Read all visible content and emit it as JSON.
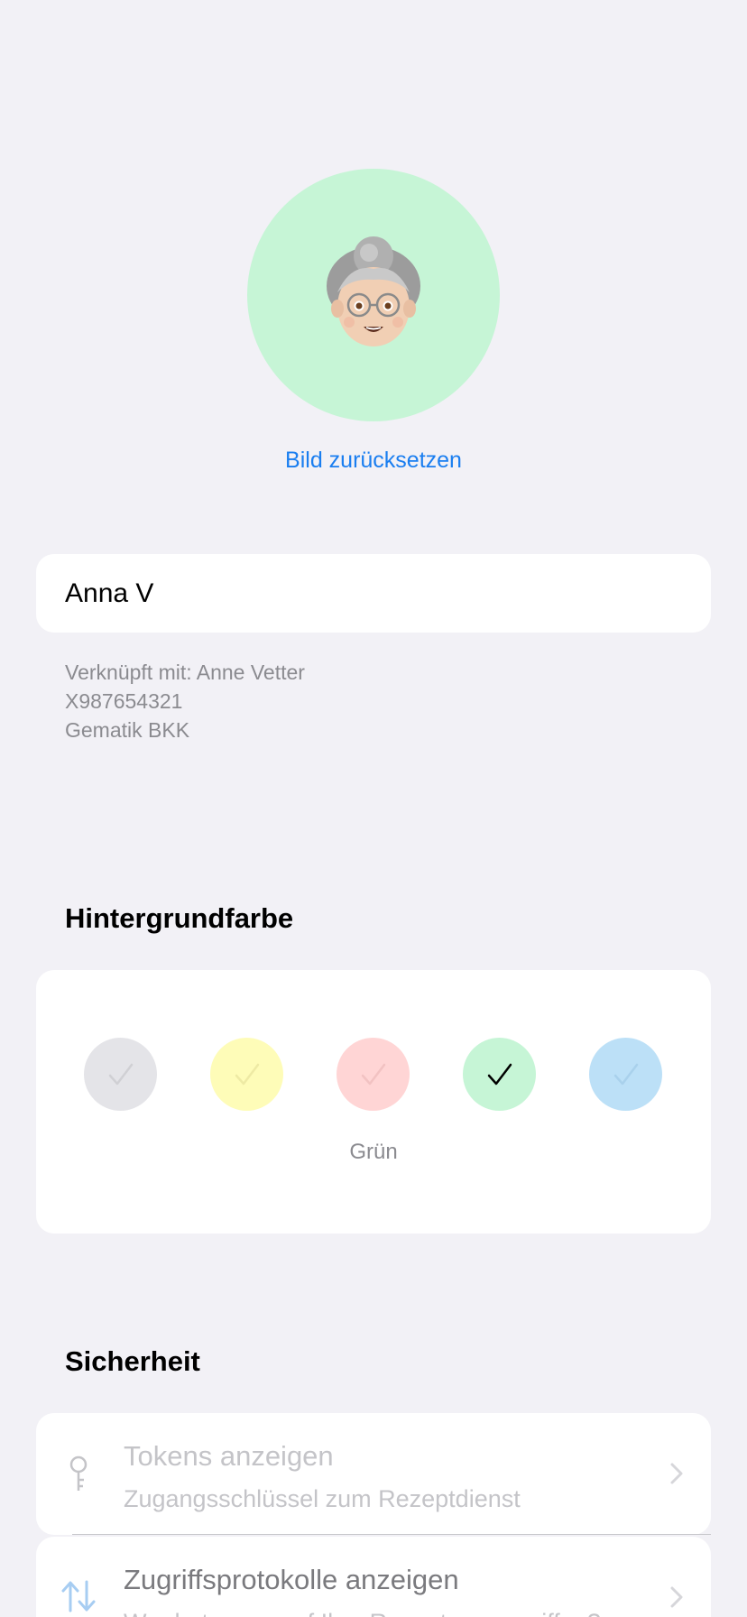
{
  "profile": {
    "reset_image_label": "Bild zurücksetzen",
    "name_value": "Anna V",
    "name_placeholder": "",
    "linked_line1": "Verknüpft mit: Anne Vetter",
    "linked_line2": "X987654321",
    "linked_line3": "Gematik BKK",
    "avatar_background": "#c6f5d6"
  },
  "background_color": {
    "title": "Hintergrundfarbe",
    "selected_label": "Grün",
    "swatches": [
      {
        "color": "#e4e4e8",
        "selected": false
      },
      {
        "color": "#fefcb8",
        "selected": false
      },
      {
        "color": "#ffd5d5",
        "selected": false
      },
      {
        "color": "#c6f5d6",
        "selected": true
      },
      {
        "color": "#bce0f7",
        "selected": false
      }
    ]
  },
  "security": {
    "title": "Sicherheit",
    "tokens": {
      "title": "Tokens anzeigen",
      "subtitle": "Zugangsschlüssel zum Rezeptdienst",
      "icon": "key-icon"
    },
    "logs": {
      "title": "Zugriffsprotokolle anzeigen",
      "subtitle": "Wer hat wann auf Ihre Rezepte zugegriffen?",
      "icon": "arrows-up-down-icon"
    }
  },
  "colors": {
    "accent": "#1a7ef0"
  }
}
